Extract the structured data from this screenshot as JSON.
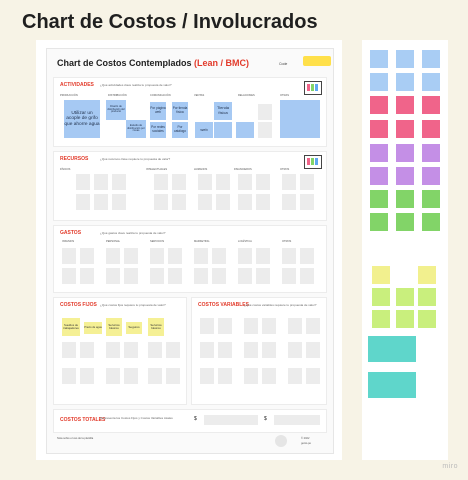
{
  "board_title": "Chart de Costos / Involucrados",
  "poster": {
    "title_main": "Chart de Costos Contemplados ",
    "title_highlight": "(Lean / BMC)",
    "code_label": "Code"
  },
  "actividades": {
    "title": "ACTIVIDADES",
    "subtitle": "¿Qué actividades clave realiza tu propuesta de valor?",
    "columns": [
      "Producción",
      "Distribución",
      "Comunicación",
      "Ventas",
      "Relaciones",
      "Otras"
    ],
    "notes": [
      "Utilizar un acople de grifo que ahorre agua",
      "Diseño de distribución del producto",
      "Estudio de distribución por zonas",
      "Por página web",
      "Por redes sociales",
      "Por tienda física",
      "Por catálogo",
      "Tienda física",
      "web"
    ]
  },
  "recursos": {
    "title": "RECURSOS",
    "subtitle": "¿Qué recursos clave requiere tu propuesta de valor?",
    "columns": [
      "Físicos",
      "Intelectuales",
      "Humanos",
      "Financieros",
      "Otros"
    ]
  },
  "gastos": {
    "title": "GASTOS",
    "subtitle": "¿Qué gastos clave realiza tu propuesta de valor?",
    "columns": [
      "Insumos",
      "Personal",
      "Servicios",
      "Marketing",
      "Logística",
      "Otros"
    ]
  },
  "costos_fijos": {
    "title": "COSTOS FIJOS",
    "subtitle": "¿Qué costos fijos requiere tu propuesta de valor?",
    "notes": [
      "Sueldos de trabajadores",
      "Precio de agua",
      "Servicios básicos",
      "Seguros",
      "Servicios básicos"
    ]
  },
  "costos_variables": {
    "title": "COSTOS VARIABLES",
    "subtitle": "¿Qué costos variables requiere tu propuesta de valor?"
  },
  "costos_totales": {
    "title": "COSTOS TOTALES",
    "subtitle": "Representa los Costos Fijos y Costos Variables totales",
    "currency_1": "$",
    "currency_2": "$"
  },
  "footer": {
    "copyright": "© 2022",
    "brand": "genio.pe",
    "note": "Nota sobre el uso de la plantilla"
  },
  "watermark": "miro",
  "colors": {
    "accent_red": "#e23a2a",
    "sticky_blue": "#a6c9f3",
    "sticky_yellow": "#f5f095",
    "board_bg": "#f7f3e6"
  },
  "palette": {
    "blue": "#a9cdf4",
    "pink": "#f0648a",
    "purple": "#c48fe6",
    "green": "#82d468",
    "light_yellow": "#f2f08e",
    "lime": "#c9ef7d",
    "teal": "#5fd6cb"
  }
}
